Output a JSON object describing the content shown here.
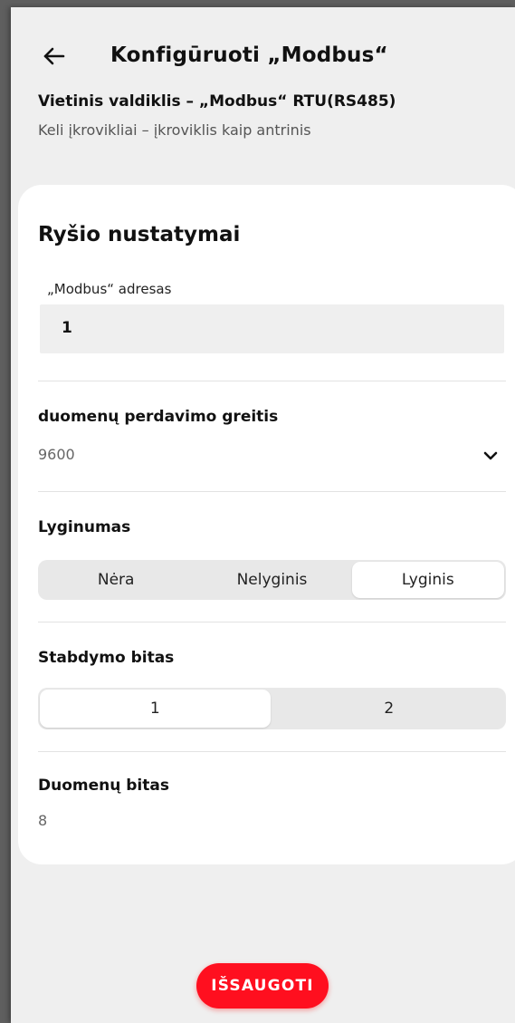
{
  "header": {
    "title": "Konfigūruoti „Modbus“",
    "subtitle": "Vietinis valdiklis – „Modbus“ RTU(RS485)",
    "description": "Keli įkrovikliai – įkroviklis kaip antrinis"
  },
  "card": {
    "title": "Ryšio nustatymai",
    "modbus_address": {
      "label": "„Modbus“ adresas",
      "value": "1"
    },
    "baud_rate": {
      "label": "duomenų perdavimo greitis",
      "value": "9600"
    },
    "parity": {
      "label": "Lyginumas",
      "options": [
        "Nėra",
        "Nelyginis",
        "Lyginis"
      ],
      "selected": "Lyginis"
    },
    "stop_bit": {
      "label": "Stabdymo bitas",
      "options": [
        "1",
        "2"
      ],
      "selected": "1"
    },
    "data_bit": {
      "label": "Duomenų bitas",
      "value": "8"
    }
  },
  "actions": {
    "save_label": "IŠSAUGOTI"
  },
  "icons": {
    "back": "arrow-left-icon",
    "dropdown": "chevron-down-icon"
  },
  "colors": {
    "accent": "#ff0f1f",
    "background": "#efefef",
    "card": "#ffffff"
  }
}
